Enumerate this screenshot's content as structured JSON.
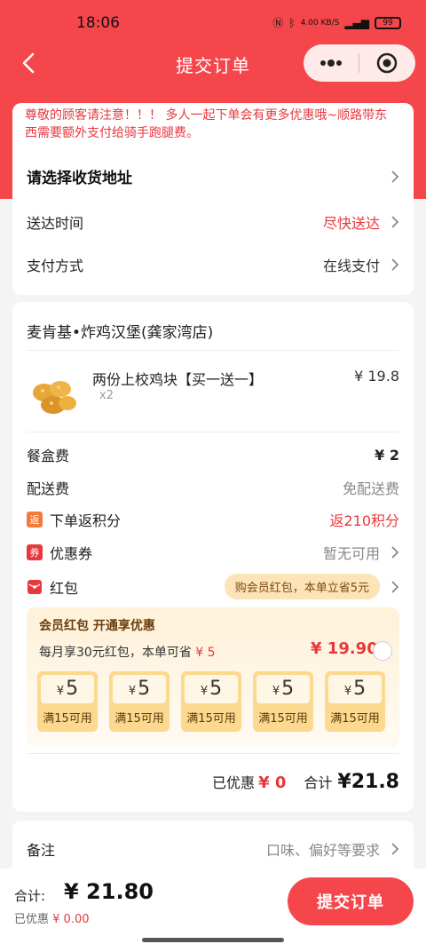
{
  "status_bar": {
    "time": "18:06",
    "net_speed": "4.00 KB/S",
    "battery": "99"
  },
  "nav": {
    "title": "提交订单"
  },
  "notice": {
    "text": "尊敬的顾客请注意！！！ 多人一起下单会有更多优惠哦~顺路带东西需要额外支付给骑手跑腿费。"
  },
  "address": {
    "label": "请选择收货地址"
  },
  "delivery_time": {
    "label": "送达时间",
    "value": "尽快送达"
  },
  "payment": {
    "label": "支付方式",
    "value": "在线支付"
  },
  "store": {
    "name": "麦肯基•炸鸡汉堡(龚家湾店)"
  },
  "item": {
    "name": "两份上校鸡块【买一送一】",
    "qty": "x2",
    "price": "¥ 19.8"
  },
  "fees": {
    "box_fee_label": "餐盒费",
    "box_fee_value": "¥ 2",
    "delivery_fee_label": "配送费",
    "delivery_fee_value": "免配送费",
    "points_label": "下单返积分",
    "points_value": "返210积分",
    "points_icon_text": "返",
    "coupon_label": "优惠券",
    "coupon_value": "暂无可用",
    "coupon_icon_text": "券",
    "redpacket_label": "红包",
    "redpacket_pill": "购会员红包，本单立省5元"
  },
  "member": {
    "title": "会员红包 开通享优惠",
    "subtitle_prefix": "每月享30元红包，本单可省",
    "subtitle_save": "¥ 5",
    "price": "¥ 19.90",
    "coupons": [
      {
        "currency": "¥",
        "amount": "5",
        "condition": "满15可用"
      },
      {
        "currency": "¥",
        "amount": "5",
        "condition": "满15可用"
      },
      {
        "currency": "¥",
        "amount": "5",
        "condition": "满15可用"
      },
      {
        "currency": "¥",
        "amount": "5",
        "condition": "满15可用"
      },
      {
        "currency": "¥",
        "amount": "5",
        "condition": "满15可用"
      }
    ]
  },
  "summary": {
    "discount_label": "已优惠",
    "discount_value": "¥ 0",
    "total_label": "合计",
    "total_value": "¥21.8"
  },
  "remark": {
    "label": "备注",
    "placeholder": "口味、偏好等要求"
  },
  "bottom": {
    "total_label": "合计:",
    "total_value": "¥ 21.80",
    "discount_label": "已优惠",
    "discount_value": "¥ 0.00",
    "submit_label": "提交订单"
  },
  "colors": {
    "primary": "#f5474b",
    "accent_red": "#e8383d",
    "member_bg": "#fff1d9",
    "coupon_gold": "#fbd98e"
  }
}
